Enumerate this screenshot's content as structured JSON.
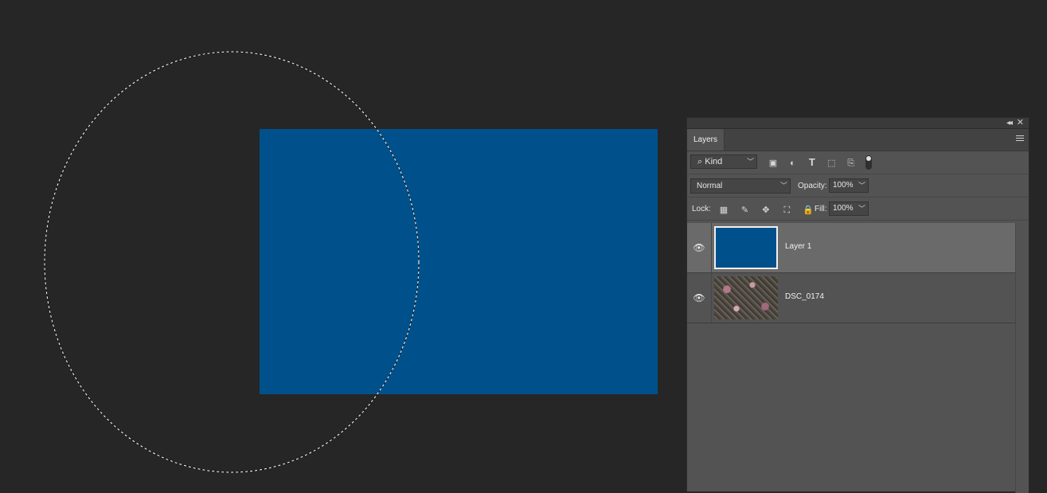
{
  "colors": {
    "canvas_bg": "#262626",
    "doc_fill": "#00518b",
    "panel_bg": "#535353",
    "selected_layer": "#6a6a6a"
  },
  "panel": {
    "tab_label": "Layers",
    "icons": [
      "collapse-icon",
      "close-icon",
      "panel-menu-icon"
    ]
  },
  "filter": {
    "kind_label": "Kind",
    "icons": [
      "pixel-filter-icon",
      "adjustment-filter-icon",
      "type-filter-icon",
      "shape-filter-icon",
      "smart-object-filter-icon",
      "filter-toggle-icon"
    ]
  },
  "blend": {
    "mode": "Normal",
    "opacity_label": "Opacity:",
    "opacity_value": "100%"
  },
  "lock": {
    "label": "Lock:",
    "icons": [
      "lock-transparent-icon",
      "lock-image-icon",
      "lock-position-icon",
      "lock-artboard-icon",
      "lock-all-icon"
    ],
    "fill_label": "Fill:",
    "fill_value": "100%"
  },
  "layers": [
    {
      "name": "Layer 1",
      "selected": true,
      "visible": true,
      "thumb": "solid-blue"
    },
    {
      "name": "DSC_0174",
      "selected": false,
      "visible": true,
      "thumb": "photo"
    }
  ]
}
